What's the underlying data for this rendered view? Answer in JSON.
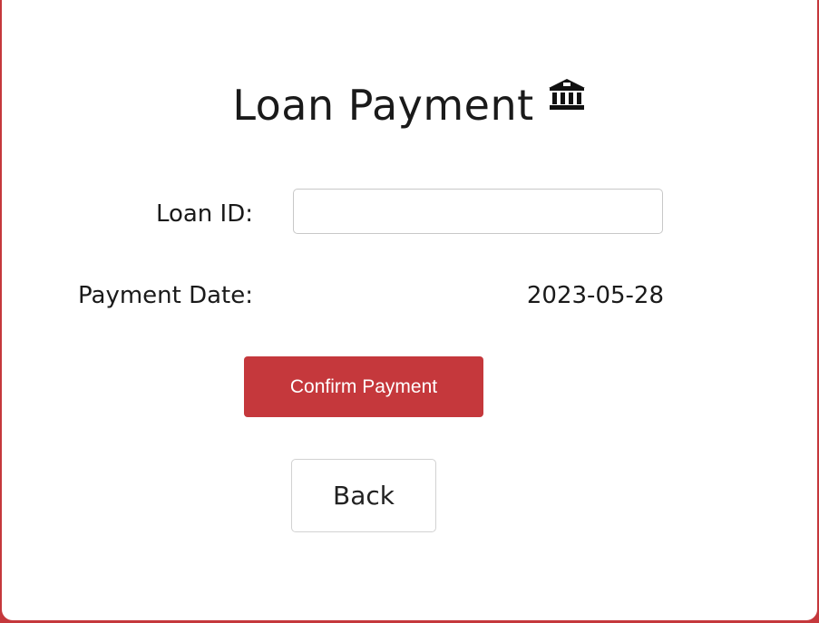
{
  "page": {
    "title": "Loan Payment",
    "title_icon": "bank-icon",
    "accent_color": "#c5383c"
  },
  "form": {
    "loan_id_label": "Loan ID:",
    "loan_id_value": "",
    "loan_id_placeholder": "",
    "payment_date_label": "Payment Date:",
    "payment_date_value": "2023-05-28"
  },
  "actions": {
    "confirm_label": "Confirm Payment",
    "back_label": "Back"
  }
}
